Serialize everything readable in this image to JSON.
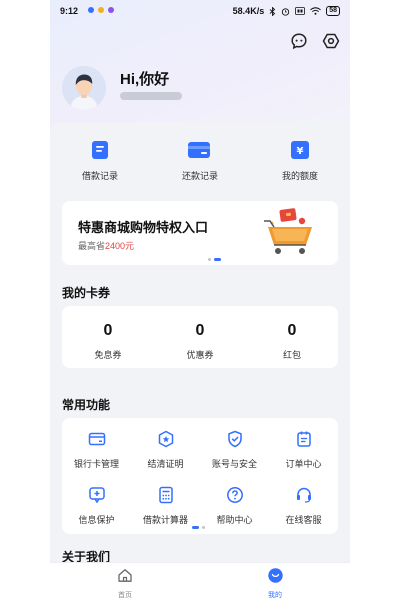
{
  "status_bar": {
    "time": "9:12",
    "network_speed": "58.4K/s",
    "battery": "58"
  },
  "colors": {
    "accent": "#3370ff",
    "highlight": "#e64340"
  },
  "user": {
    "greeting": "Hi,你好"
  },
  "quick_actions": [
    {
      "label": "借款记录",
      "icon": "loan-record-icon"
    },
    {
      "label": "还款记录",
      "icon": "repay-record-icon"
    },
    {
      "label": "我的额度",
      "icon": "credit-limit-icon"
    }
  ],
  "promo": {
    "title": "特惠商城购物特权入口",
    "subtitle_prefix": "最高省",
    "amount": "2400元"
  },
  "coupons": {
    "title": "我的卡券",
    "items": [
      {
        "value": "0",
        "label": "免息券"
      },
      {
        "value": "0",
        "label": "优惠券"
      },
      {
        "value": "0",
        "label": "红包"
      }
    ]
  },
  "functions": {
    "title": "常用功能",
    "items": [
      {
        "label": "银行卡管理",
        "icon": "bank-card-icon"
      },
      {
        "label": "结清证明",
        "icon": "settlement-certificate-icon"
      },
      {
        "label": "账号与安全",
        "icon": "shield-icon"
      },
      {
        "label": "订单中心",
        "icon": "order-icon"
      },
      {
        "label": "信息保护",
        "icon": "info-protect-icon"
      },
      {
        "label": "借款计算器",
        "icon": "calculator-icon"
      },
      {
        "label": "帮助中心",
        "icon": "help-icon"
      },
      {
        "label": "在线客服",
        "icon": "headset-icon"
      }
    ]
  },
  "about": {
    "title": "关于我们"
  },
  "tabbar": [
    {
      "label": "首页",
      "icon": "home-icon",
      "active": false
    },
    {
      "label": "我的",
      "icon": "profile-icon",
      "active": true
    }
  ]
}
